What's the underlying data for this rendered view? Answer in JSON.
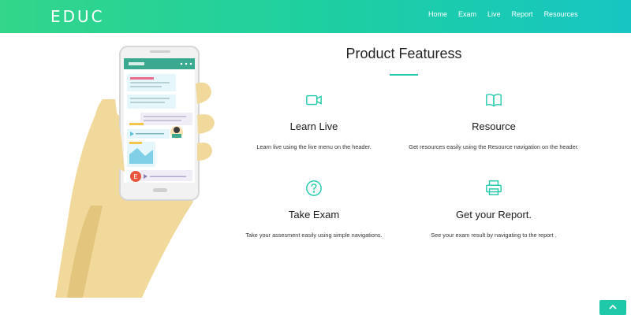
{
  "brand": {
    "name": "EDUC"
  },
  "nav": {
    "items": [
      {
        "label": "Home"
      },
      {
        "label": "Exam"
      },
      {
        "label": "Live"
      },
      {
        "label": "Report"
      },
      {
        "label": "Resources"
      }
    ]
  },
  "features_section": {
    "title": "Product Featuress",
    "items": [
      {
        "icon": "video-camera-icon",
        "title": "Learn Live",
        "description": "Learn live using the live menu on the header."
      },
      {
        "icon": "book-icon",
        "title": "Resource",
        "description": "Get resources easily using the Resource navigation on the header."
      },
      {
        "icon": "question-circle-icon",
        "title": "Take Exam",
        "description": "Take your assesment easily using simple navigations."
      },
      {
        "icon": "printer-icon",
        "title": "Get your Report.",
        "description": "See your exam result by navigating to the report ."
      }
    ]
  },
  "phone_chat": {
    "avatar_letter": "E"
  },
  "back_to_top": {
    "icon": "chevron-up-icon"
  },
  "colors": {
    "accent": "#1ec8a8",
    "gradient_start": "#33d68a",
    "gradient_end": "#17c6c2"
  }
}
